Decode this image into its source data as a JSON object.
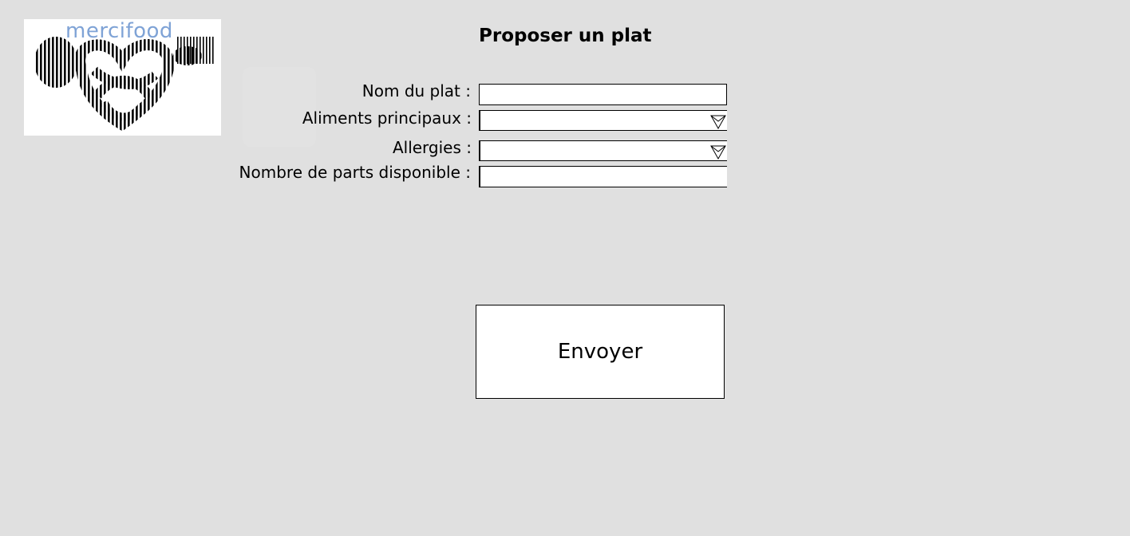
{
  "logo": {
    "text": "mercifood",
    "text_color": "#7fa3d6"
  },
  "page_title": "Proposer un plat",
  "form": {
    "dish_name": {
      "label": "Nom du plat :",
      "value": "",
      "placeholder": ""
    },
    "main_ingredients": {
      "label": "Aliments principaux :",
      "selected": "",
      "icon": "chevron-down-icon"
    },
    "allergies": {
      "label": "Allergies :",
      "selected": "",
      "icon": "chevron-down-icon"
    },
    "portions": {
      "label": "Nombre de parts disponible :",
      "value": "",
      "placeholder": ""
    }
  },
  "submit": {
    "label": "Envoyer"
  },
  "colors": {
    "background": "#e0e0e0",
    "field_background": "#ffffff",
    "border": "#000000"
  }
}
